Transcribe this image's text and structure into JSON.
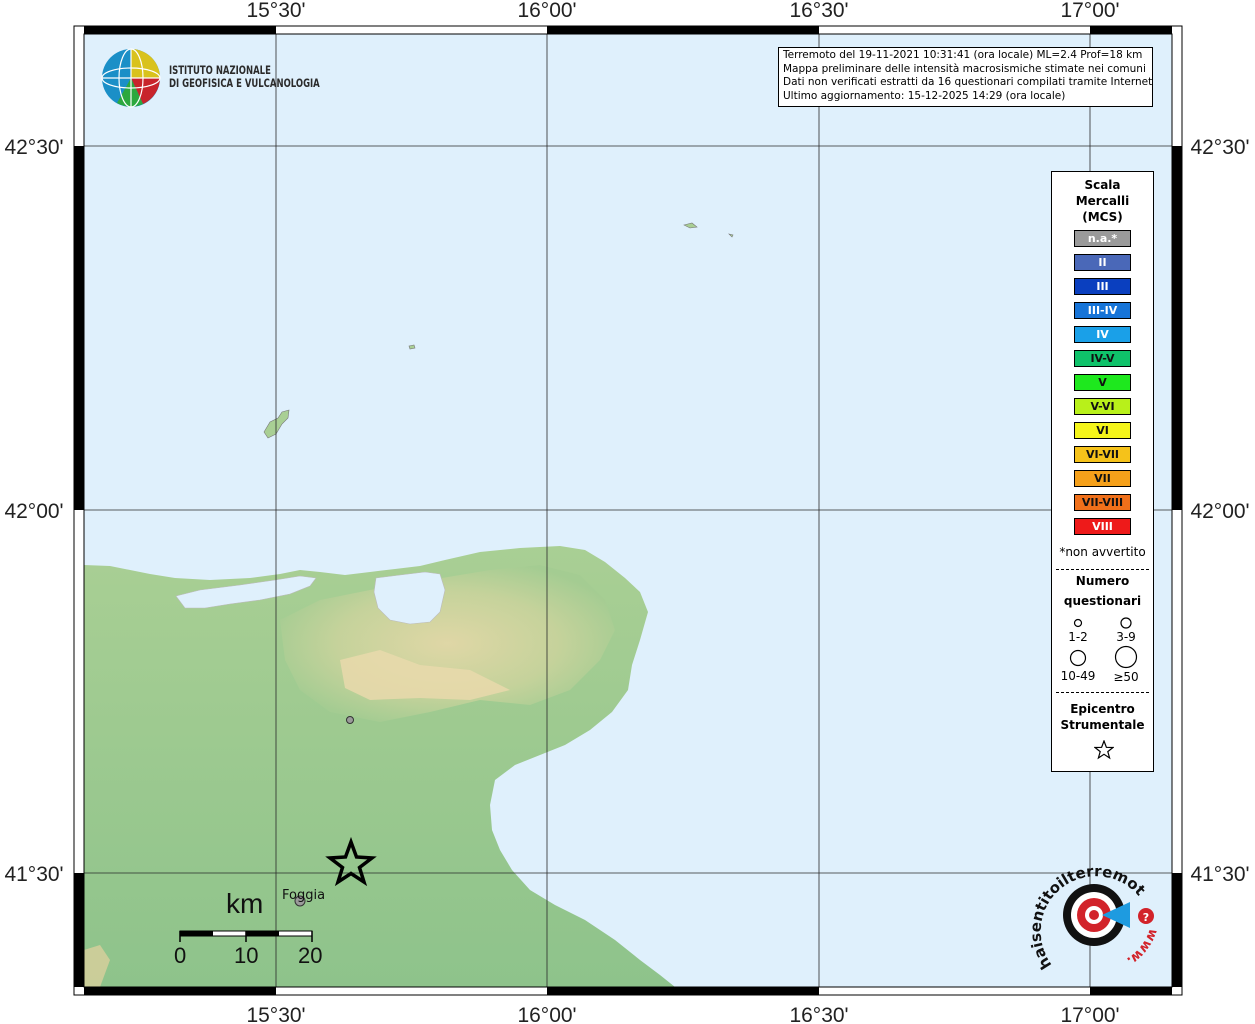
{
  "tick_labels": {
    "lon": [
      "15°30'",
      "16°00'",
      "16°30'",
      "17°00'"
    ],
    "lat": [
      "42°30'",
      "42°00'",
      "41°30'"
    ]
  },
  "institute": {
    "line1": "ISTITUTO NAZIONALE",
    "line2": "DI GEOFISICA E VULCANOLOGIA"
  },
  "info": {
    "line1": "Terremoto del 19-11-2021 10:31:41 (ora locale) ML=2.4 Prof=18 km",
    "line2": "Mappa preliminare delle intensità macrosismiche stimate nei comuni",
    "line3": "Dati non verificati estratti da 16 questionari compilati tramite Internet.",
    "line4": "Ultimo aggiornamento: 15-12-2025 14:29 (ora locale)"
  },
  "legend": {
    "title1": "Scala",
    "title2": "Mercalli",
    "title3": "(MCS)",
    "scale": [
      {
        "label": "n.a.*",
        "color": "#9a9a9a",
        "text": "#ffffff"
      },
      {
        "label": "II",
        "color": "#4a68b8",
        "text": "#ffffff"
      },
      {
        "label": "III",
        "color": "#0a3fbf",
        "text": "#ffffff"
      },
      {
        "label": "III-IV",
        "color": "#1674d8",
        "text": "#ffffff"
      },
      {
        "label": "IV",
        "color": "#1aa0e8",
        "text": "#ffffff"
      },
      {
        "label": "IV-V",
        "color": "#0fc26a",
        "text": "#111111"
      },
      {
        "label": "V",
        "color": "#1ee81e",
        "text": "#111111"
      },
      {
        "label": "V-VI",
        "color": "#b8f01a",
        "text": "#111111"
      },
      {
        "label": "VI",
        "color": "#f5f51a",
        "text": "#111111"
      },
      {
        "label": "VI-VII",
        "color": "#f5c21a",
        "text": "#111111"
      },
      {
        "label": "VII",
        "color": "#f5a01a",
        "text": "#111111"
      },
      {
        "label": "VII-VIII",
        "color": "#f0701a",
        "text": "#111111"
      },
      {
        "label": "VIII",
        "color": "#ee1a1a",
        "text": "#ffffff"
      }
    ],
    "note": "*non avvertito",
    "count_title1": "Numero",
    "count_title2": "questionari",
    "counts": [
      "1-2",
      "3-9",
      "10-49",
      "≥50"
    ],
    "epi_title1": "Epicentro",
    "epi_title2": "Strumentale"
  },
  "places": {
    "city": "Foggia"
  },
  "scalebar": {
    "unit": "km",
    "ticks": [
      "0",
      "10",
      "20"
    ]
  },
  "brand": {
    "text": "haisentitoilterremoto.it",
    "www": "www.",
    "colors": {
      "red": "#d2232a",
      "black": "#111111",
      "blue": "#1e9be0"
    }
  },
  "colors": {
    "sea": "#dff0fc",
    "land_low": "#8dc587",
    "land_high": "#e3d6a8"
  }
}
